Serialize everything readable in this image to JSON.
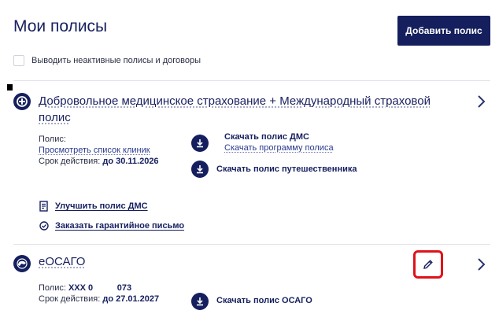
{
  "header": {
    "title": "Мои полисы",
    "add_button": "Добавить полис"
  },
  "filters": {
    "inactive_label": "Выводить неактивные полисы и договоры",
    "inactive_checked": false
  },
  "policies": [
    {
      "title_line1": "Добровольное медицинское страхование + Международный страховой",
      "title_line2": "полис",
      "meta_label": "Полис:",
      "clinics_link": "Просмотреть список клиник",
      "validity_label": "Срок действия:",
      "validity_value": "до 30.11.2026",
      "download_main": "Скачать полис ДМС",
      "download_program": "Скачать программу полиса",
      "download_travel": "Скачать полис путешественника",
      "improve_link": "Улучшить полис ДМС",
      "guarantee_link": "Заказать гарантийное письмо"
    },
    {
      "title": "еОСАГО",
      "policy_label": "Полис:",
      "policy_number": "ХХХ 0          073",
      "validity_label": "Срок действия:",
      "validity_value": "до 27.01.2027",
      "download": "Скачать полис ОСАГО"
    }
  ],
  "colors": {
    "primary": "#151f5e",
    "link": "#2a3a8f",
    "highlight": "#e0121b"
  }
}
